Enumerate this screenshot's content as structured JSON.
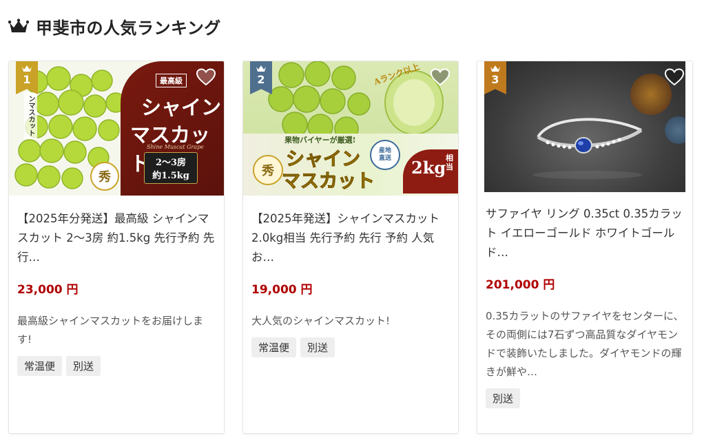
{
  "heading": {
    "title": "甲斐市の人気ランキング",
    "icon": "crown-icon"
  },
  "colors": {
    "price": "#b00000",
    "rank1": "#c9a227",
    "rank2": "#4f6f8f",
    "rank3": "#c07a1e"
  },
  "cards": [
    {
      "rank": "1",
      "image_text": {
        "badge": "最高級",
        "line1": "シャイン",
        "line2": "マスカット",
        "sub": "Shine Muscat Grape",
        "box1": "2〜3房",
        "box2": "約1.5kg",
        "seal": "秀",
        "side": "ンマスカット"
      },
      "title": "【2025年分発送】最高級 シャインマスカット 2〜3房 約1.5kg 先行予約 先行…",
      "price": "23,000 円",
      "description": "最高級シャインマスカットをお届けします!",
      "tags": [
        "常温便",
        "別送"
      ]
    },
    {
      "rank": "2",
      "image_text": {
        "ribbon": "Aランク以上",
        "buyer": "果物バイヤーが厳選!",
        "line1": "シャイン",
        "line2": "マスカット",
        "seal": "秀",
        "stamp": "産地直送",
        "weight": "2kg",
        "weight_suffix": "相当"
      },
      "title": "【2025年発送】シャインマスカット 2.0kg相当 先行予約 先行 予約 人気 お…",
      "price": "19,000 円",
      "description": "大人気のシャインマスカット!",
      "tags": [
        "常温便",
        "別送"
      ]
    },
    {
      "rank": "3",
      "title": "サファイヤ リング 0.35ct 0.35カラット イエローゴールド ホワイトゴールド…",
      "price": "201,000 円",
      "description": "0.35カラットのサファイヤをセンターに、その両側には7石ずつ高品質なダイヤモンドで装飾いたしました。ダイヤモンドの輝きが鮮や…",
      "tags": [
        "別送"
      ]
    }
  ]
}
